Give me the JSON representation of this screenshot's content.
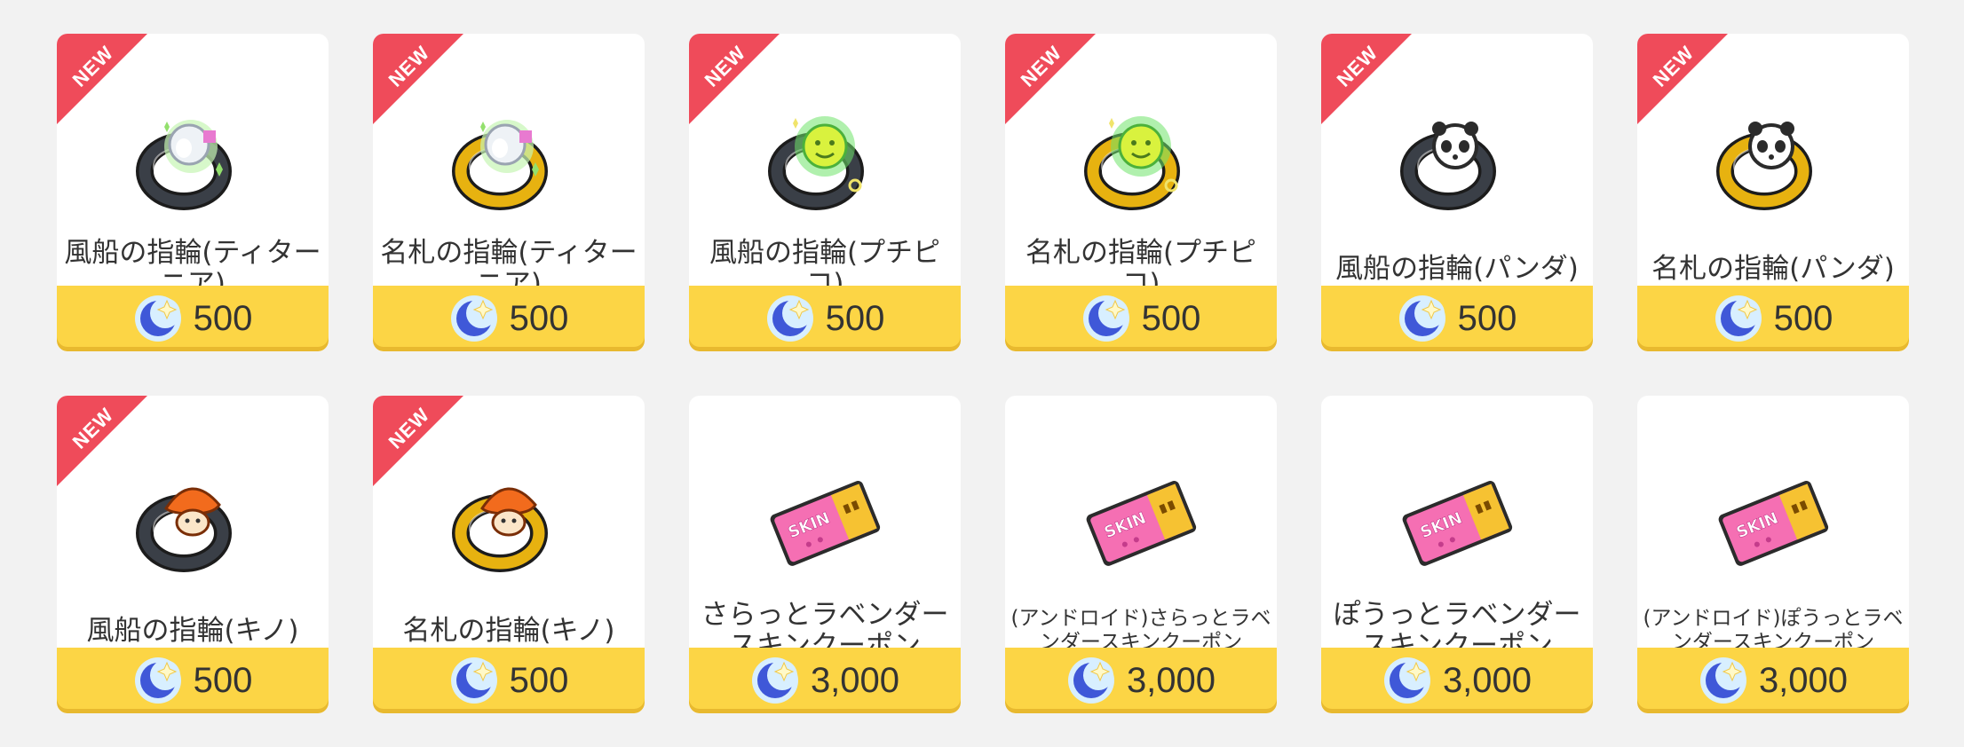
{
  "products": [
    {
      "name": "風船の指輪(ティターニア)",
      "price": "500",
      "is_new": true,
      "badge": "NEW",
      "icon": "ring-titania-icon",
      "band_color": "#3a3f47",
      "small": false
    },
    {
      "name": "名札の指輪(ティターニア)",
      "price": "500",
      "is_new": true,
      "badge": "NEW",
      "icon": "ring-titania-icon",
      "band_color": "#e7b210",
      "small": false
    },
    {
      "name": "風船の指輪(プチピコ)",
      "price": "500",
      "is_new": true,
      "badge": "NEW",
      "icon": "ring-puchipico-icon",
      "band_color": "#3a3f47",
      "small": false
    },
    {
      "name": "名札の指輪(プチピコ)",
      "price": "500",
      "is_new": true,
      "badge": "NEW",
      "icon": "ring-puchipico-icon",
      "band_color": "#e7b210",
      "small": false
    },
    {
      "name": "風船の指輪(パンダ)",
      "price": "500",
      "is_new": true,
      "badge": "NEW",
      "icon": "ring-panda-icon",
      "band_color": "#3a3f47",
      "small": false
    },
    {
      "name": "名札の指輪(パンダ)",
      "price": "500",
      "is_new": true,
      "badge": "NEW",
      "icon": "ring-panda-icon",
      "band_color": "#e7b210",
      "small": false
    },
    {
      "name": "風船の指輪(キノ)",
      "price": "500",
      "is_new": true,
      "badge": "NEW",
      "icon": "ring-kino-icon",
      "band_color": "#3a3f47",
      "small": false
    },
    {
      "name": "名札の指輪(キノ)",
      "price": "500",
      "is_new": true,
      "badge": "NEW",
      "icon": "ring-kino-icon",
      "band_color": "#e7b210",
      "small": false
    },
    {
      "name": "さらっとラベンダースキンクーポン",
      "price": "3,000",
      "is_new": false,
      "badge": "",
      "icon": "skin-coupon-icon",
      "band_color": "#f56fb3",
      "small": false
    },
    {
      "name": "(アンドロイド)さらっとラベンダースキンクーポン",
      "price": "3,000",
      "is_new": false,
      "badge": "",
      "icon": "skin-coupon-icon",
      "band_color": "#f56fb3",
      "small": true
    },
    {
      "name": "ぽうっとラベンダースキンクーポン",
      "price": "3,000",
      "is_new": false,
      "badge": "",
      "icon": "skin-coupon-icon",
      "band_color": "#f56fb3",
      "small": false
    },
    {
      "name": "(アンドロイド)ぽうっとラベンダースキンクーポン",
      "price": "3,000",
      "is_new": false,
      "badge": "",
      "icon": "skin-coupon-icon",
      "band_color": "#f56fb3",
      "small": true
    }
  ],
  "currency_icon": "moon-currency-icon",
  "colors": {
    "price_bar": "#fcd545",
    "new_ribbon": "#ef4b5a",
    "background": "#f2f2f2"
  }
}
